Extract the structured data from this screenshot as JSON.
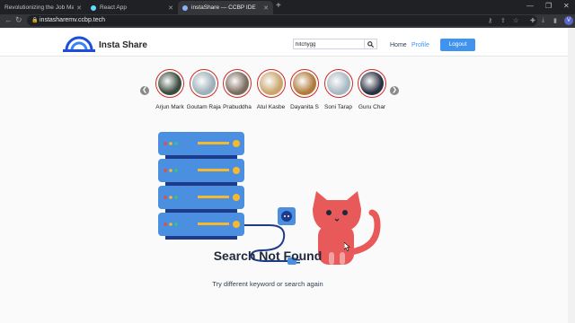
{
  "browser": {
    "tabs": [
      {
        "title": "Revolutionizing the Job Market |",
        "active": false
      },
      {
        "title": "React App",
        "active": false
      },
      {
        "title": "instaShare — CCBP IDE",
        "active": true
      }
    ],
    "url": "instasharemv.ccbp.tech",
    "profile_initial": "V"
  },
  "header": {
    "brand": "Insta Share",
    "search_value": "hitchygg",
    "nav": {
      "home": "Home",
      "profile": "Profile"
    },
    "logout": "Logout"
  },
  "stories": [
    {
      "name": "Arjun Mark",
      "color": "#3a4a3c"
    },
    {
      "name": "Goutam Raja",
      "color": "#9bb0b8"
    },
    {
      "name": "Prabuddha",
      "color": "#7a6b5c"
    },
    {
      "name": "Atul Kasbe",
      "color": "#c9a56a"
    },
    {
      "name": "Dayanita S",
      "color": "#b07a3a"
    },
    {
      "name": "Soni Tarap",
      "color": "#a8b8c2"
    },
    {
      "name": "Guru Char",
      "color": "#2a3142"
    }
  ],
  "not_found": {
    "title": "Search Not Found",
    "subtitle": "Try different keyword or search again"
  },
  "colors": {
    "primary": "#4094ef",
    "story_ring": "#d02a2a",
    "server": "#4a8fe0",
    "cat": "#e85a5a"
  }
}
